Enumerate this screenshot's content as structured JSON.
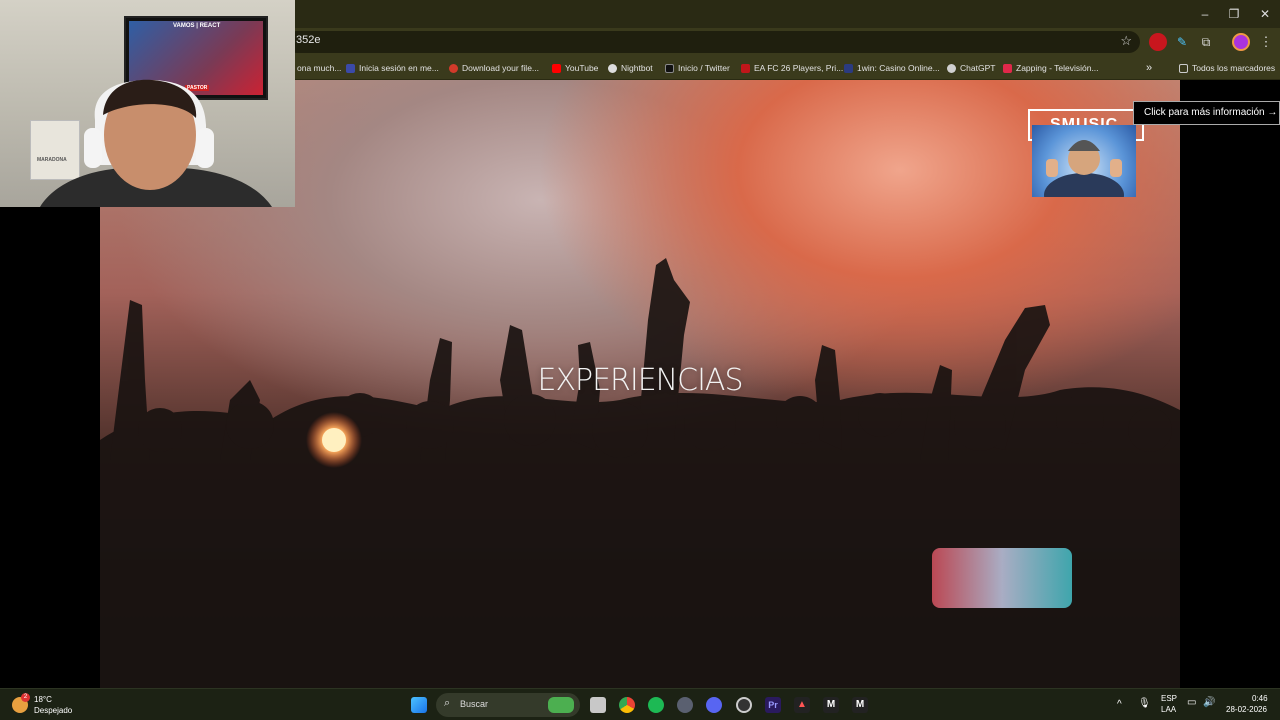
{
  "browser": {
    "url_fragment": "352e",
    "window_controls": [
      "–",
      "❐",
      "✕"
    ],
    "bookmarks": [
      {
        "label": "ona much...",
        "color": "#5a5a5a"
      },
      {
        "label": "Inicia sesión en me...",
        "color": "#3b4aa8"
      },
      {
        "label": "Download your file...",
        "color": "#d23a2a"
      },
      {
        "label": "YouTube",
        "color": "#ff0000"
      },
      {
        "label": "Nightbot",
        "color": "#dddddd"
      },
      {
        "label": "Inicio / Twitter",
        "color": "#111111"
      },
      {
        "label": "EA FC 26 Players, Pri...",
        "color": "#c0161a"
      },
      {
        "label": "1win: Casino Online...",
        "color": "#2b3b80"
      },
      {
        "label": "ChatGPT",
        "color": "#d0d0d0"
      },
      {
        "label": "Zapping - Televisión...",
        "color": "#e0284a"
      }
    ],
    "bookmarks_overflow": "»",
    "all_bookmarks": "Todos los marcadores"
  },
  "page": {
    "hero_title": "EXPERIENCIAS",
    "brand": "SMUSIC",
    "cta": "Click para más información →"
  },
  "webcam": {
    "tv_top": "VAMOS | REACT",
    "tv_bottom": "PASTOR",
    "poster": "MARADONA"
  },
  "taskbar": {
    "temperature": "18°C",
    "condition": "Despejado",
    "weather_badge": "2",
    "search_placeholder": "Buscar",
    "language_1": "ESP",
    "language_2": "LAA",
    "time": "0:46",
    "date": "28-02-2026"
  }
}
